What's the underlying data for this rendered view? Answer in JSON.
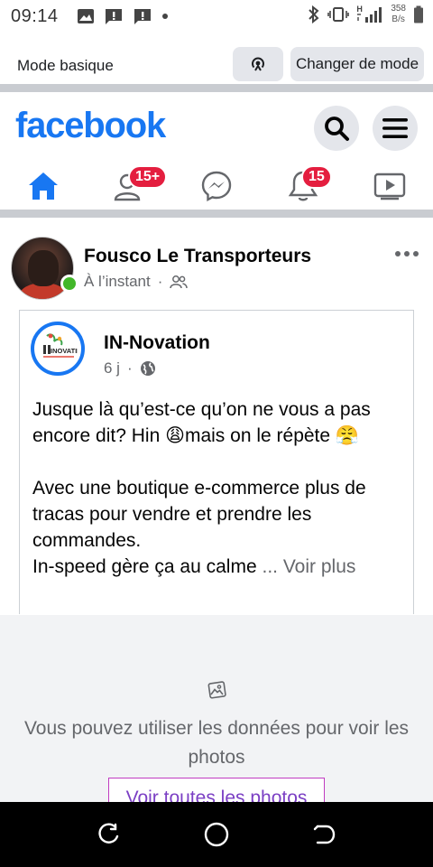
{
  "status_bar": {
    "time": "09:14",
    "speed_value": "358",
    "speed_unit": "B/s",
    "network_label": "H"
  },
  "mode_bar": {
    "label": "Mode basique",
    "switch_label": "Changer de mode"
  },
  "header": {
    "logo": "facebook"
  },
  "nav": {
    "friends_badge": "15+",
    "notifications_badge": "15"
  },
  "post": {
    "author": "Fousco Le Transporteurs",
    "time": "À l’instant",
    "separator": "·",
    "shared": {
      "page_name": "IN-Novation",
      "page_logo_text": "INOVATIK",
      "time": "6 j",
      "separator": "·",
      "paragraph1": "Jusque là qu’est-ce qu’on ne vous a pas encore dit? Hin 😩mais on le répète 😤",
      "paragraph2_line1": "Avec une boutique e-commerce plus de tracas pour vendre et prendre les commandes.",
      "paragraph2_line2": "In-speed gère ça au calme ",
      "see_more": "... Voir plus"
    }
  },
  "data_saver": {
    "message": "Vous pouvez utiliser les données pour voir les photos",
    "button": "Voir toutes les photos"
  },
  "colors": {
    "brand_blue": "#1877f2",
    "badge_red": "#e41e3f",
    "online_green": "#42b72a",
    "saver_button_border": "#c13cc1"
  }
}
